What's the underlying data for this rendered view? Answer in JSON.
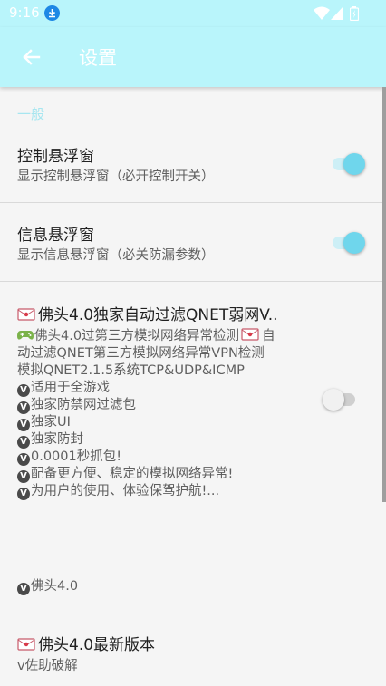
{
  "status_bar": {
    "time": "9:16"
  },
  "app_bar": {
    "title": "设置"
  },
  "section": {
    "header": "一般"
  },
  "prefs": [
    {
      "title": "控制悬浮窗",
      "summary": "显示控制悬浮窗（必开控制开关）",
      "checked": true
    },
    {
      "title": "信息悬浮窗",
      "summary": "显示信息悬浮窗（必关防漏参数）",
      "checked": true
    }
  ],
  "feature": {
    "title": "佛头4.0独家自动过滤QNET弱网V..",
    "lines": [
      "佛头4.0过第三方模拟网络异常检测",
      "自",
      "动过滤QNET第三方模拟网络异常VPN检测",
      "模拟QNET2.1.5系统TCP&UDP&ICMP",
      "适用于全游戏",
      "独家防禁网过滤包",
      "独家UI",
      "独家防封",
      "0.0001秒抓包!",
      "配备更方便、稳定的模拟网络异常!",
      "为用户的使用、体验保驾护航!..."
    ],
    "checked": false
  },
  "version_label": "佛头4.0",
  "latest": {
    "title": "佛头4.0最新版本",
    "summary": "v佐助破解"
  },
  "colors": {
    "accent": "#6fd6ec",
    "app_bar": "#b9f5fb",
    "section_header": "#a7e6f0"
  }
}
